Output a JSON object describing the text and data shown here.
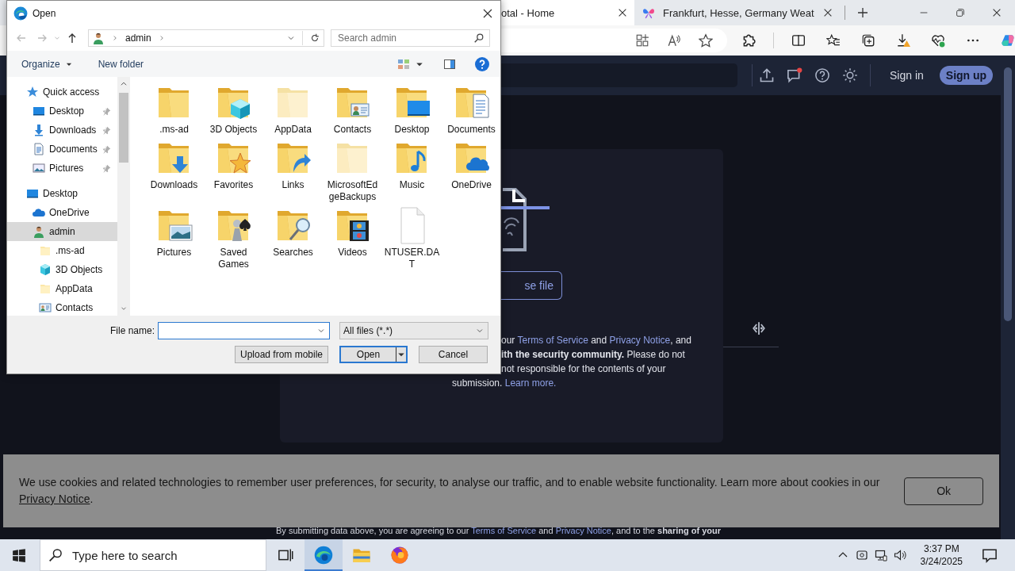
{
  "browser": {
    "tabs": [
      {
        "title": "otal - Home",
        "selected": true
      },
      {
        "title": "Frankfurt, Hesse, Germany Weat",
        "selected": false
      }
    ]
  },
  "page": {
    "sign_in": "Sign in",
    "sign_up": "Sign up",
    "upload_button": "se file",
    "notice_lines": [
      [
        {
          "kind": "text",
          "text": "our "
        },
        {
          "kind": "link",
          "text": "Terms of Service"
        },
        {
          "kind": "text",
          "text": " and "
        },
        {
          "kind": "link",
          "text": "Privacy Notice"
        },
        {
          "kind": "text",
          "text": ", and"
        }
      ],
      [
        {
          "kind": "bold",
          "text": "ith the security community."
        },
        {
          "kind": "text",
          "text": " Please do not"
        }
      ],
      [
        {
          "kind": "text",
          "text": "not responsible for the contents of your"
        }
      ],
      [
        {
          "kind": "text",
          "text": "submission. "
        },
        {
          "kind": "link",
          "text": "Learn more."
        }
      ]
    ],
    "footer_line": [
      {
        "kind": "text",
        "text": "By submitting data above, you are agreeing to our "
      },
      {
        "kind": "link",
        "text": "Terms of Service"
      },
      {
        "kind": "text",
        "text": " and "
      },
      {
        "kind": "link",
        "text": "Privacy Notice"
      },
      {
        "kind": "text",
        "text": ", and to the "
      },
      {
        "kind": "bold",
        "text": "sharing of your"
      }
    ]
  },
  "cookie_banner": {
    "text": [
      {
        "kind": "text",
        "text": "We use cookies and related technologies to remember user preferences, for security, to analyse our traffic, and to enable website functionality. Learn more about cookies in our "
      },
      {
        "kind": "link",
        "text": "Privacy Notice"
      },
      {
        "kind": "text",
        "text": "."
      }
    ],
    "button": "Ok"
  },
  "dialog": {
    "title": "Open",
    "breadcrumb": "admin",
    "search_placeholder": "Search admin",
    "organize": "Organize",
    "new_folder": "New folder",
    "nav_tree": [
      {
        "label": "Quick access",
        "kind": "star",
        "selected": false,
        "children": [
          {
            "label": "Desktop",
            "kind": "desktop",
            "pinned": true,
            "selected": false
          },
          {
            "label": "Downloads",
            "kind": "downloads",
            "pinned": true,
            "selected": false
          },
          {
            "label": "Documents",
            "kind": "documents",
            "pinned": true,
            "selected": false
          },
          {
            "label": "Pictures",
            "kind": "pictures",
            "pinned": true,
            "selected": false
          }
        ]
      },
      {
        "label": "Desktop",
        "kind": "desktop",
        "selected": false,
        "children": [
          {
            "label": "OneDrive",
            "kind": "onedrive",
            "selected": false
          },
          {
            "label": "admin",
            "kind": "user",
            "selected": true,
            "children": [
              {
                "label": ".ms-ad",
                "kind": "hidden",
                "selected": false
              },
              {
                "label": "3D Objects",
                "kind": "cube",
                "selected": false
              },
              {
                "label": "AppData",
                "kind": "hidden",
                "selected": false
              },
              {
                "label": "Contacts",
                "kind": "contacts",
                "selected": false
              }
            ]
          }
        ]
      }
    ],
    "items": [
      {
        "name": ".ms-ad",
        "kind": "folder"
      },
      {
        "name": "3D Objects",
        "kind": "cube"
      },
      {
        "name": "AppData",
        "kind": "hidden"
      },
      {
        "name": "Contacts",
        "kind": "contacts"
      },
      {
        "name": "Desktop",
        "kind": "desktop"
      },
      {
        "name": "Documents",
        "kind": "documents"
      },
      {
        "name": "Downloads",
        "kind": "downloads"
      },
      {
        "name": "Favorites",
        "kind": "favorites"
      },
      {
        "name": "Links",
        "kind": "links"
      },
      {
        "name": "MicrosoftEdgeBackups",
        "kind": "hidden"
      },
      {
        "name": "Music",
        "kind": "music"
      },
      {
        "name": "OneDrive",
        "kind": "onedrive"
      },
      {
        "name": "Pictures",
        "kind": "pictures"
      },
      {
        "name": "Saved Games",
        "kind": "games"
      },
      {
        "name": "Searches",
        "kind": "searches"
      },
      {
        "name": "Videos",
        "kind": "videos"
      },
      {
        "name": "NTUSER.DAT",
        "kind": "file"
      }
    ],
    "file_name_label": "File name:",
    "file_type": "All files (*.*)",
    "buttons": [
      {
        "label": "Upload from mobile",
        "kind": "plain",
        "default": false
      },
      {
        "label": "Open",
        "kind": "split",
        "default": true
      },
      {
        "label": "Cancel",
        "kind": "plain",
        "default": false
      }
    ]
  },
  "taskbar": {
    "search_placeholder": "Type here to search",
    "apps": [
      {
        "kind": "browser",
        "selected": true
      },
      {
        "kind": "explorer",
        "selected": false
      },
      {
        "kind": "firefox",
        "selected": false
      }
    ],
    "time": "3:37 PM",
    "date": "3/24/2025"
  }
}
